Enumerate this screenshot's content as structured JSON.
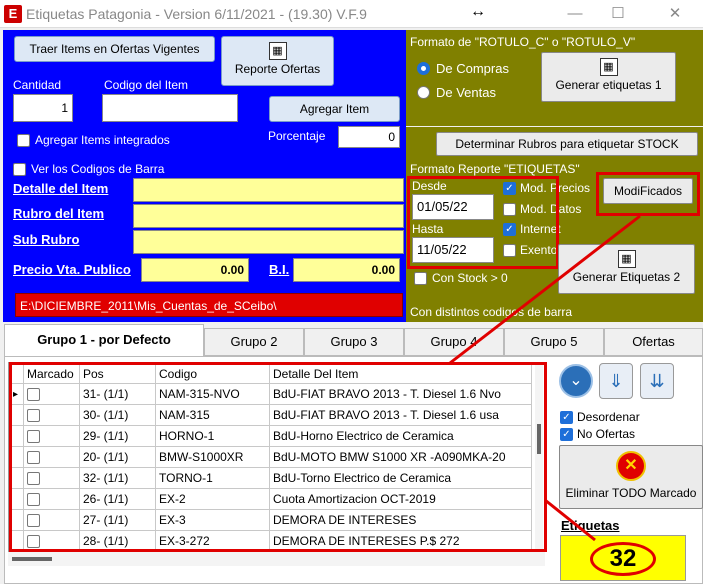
{
  "window": {
    "title": "Etiquetas Patagonia - Version 6/11/2021 - (19.30)  V.F.9",
    "resize_glyph": "↔",
    "minimize": "—",
    "maximize": "☐",
    "close": "✕"
  },
  "top_left": {
    "traer_btn": "Traer Items en Ofertas Vigentes",
    "reporte_btn": "Reporte Ofertas",
    "cantidad_label": "Cantidad",
    "cantidad_value": "1",
    "codigo_label": "Codigo del Item",
    "codigo_value": "",
    "agregar_btn": "Agregar Item",
    "integrados_label": "Agregar Items integrados",
    "porcentaje_label": "Porcentaje",
    "porcentaje_value": "0",
    "ver_codigos_label": "Ver los Codigos de Barra",
    "detalle_label": "Detalle del Item",
    "rubro_label": "Rubro del Item",
    "subrubro_label": "Sub Rubro",
    "precio_label": "Precio Vta. Publico",
    "precio_value": "0.00",
    "bi_label": "B.I.",
    "bi_value": "0.00",
    "path": "E:\\DICIEMBRE_2011\\Mis_Cuentas_de_SCeibo\\"
  },
  "right": {
    "formato_label": "Formato de \"ROTULO_C\" o \"ROTULO_V\"",
    "compras_label": "De Compras",
    "ventas_label": "De Ventas",
    "gen1_btn": "Generar etiquetas 1",
    "determinar_btn": "Determinar Rubros para etiquetar STOCK",
    "formato_rep_label": "Formato Reporte \"ETIQUETAS\"",
    "desde_label": "Desde",
    "desde_value": "01/05/22",
    "hasta_label": "Hasta",
    "hasta_value": "11/05/22",
    "mod_precios": "Mod. Precios",
    "mod_datos": "Mod. Datos",
    "internet": "Internet",
    "exentos": "Exentos",
    "modificados_btn": "ModiFicados",
    "gen2_btn": "Generar Etiquetas 2",
    "con_stock": "Con Stock > 0",
    "distintos": "Con distintos codigos de barra"
  },
  "tabs": [
    "Grupo 1 - por Defecto",
    "Grupo 2",
    "Grupo 3",
    "Grupo 4",
    "Grupo 5",
    "Ofertas"
  ],
  "grid": {
    "headers": [
      "Marcado",
      "Pos",
      "Codigo",
      "Detalle Del Item"
    ],
    "rows": [
      {
        "pos": "31- (1/1)",
        "codigo": "NAM-315-NVO",
        "detalle": "BdU-FIAT BRAVO 2013 - T. Diesel 1.6 Nvo"
      },
      {
        "pos": "30- (1/1)",
        "codigo": "NAM-315",
        "detalle": "BdU-FIAT BRAVO 2013 - T. Diesel 1.6 usa"
      },
      {
        "pos": "29- (1/1)",
        "codigo": "HORNO-1",
        "detalle": "BdU-Horno Electrico de Ceramica"
      },
      {
        "pos": "20- (1/1)",
        "codigo": "BMW-S1000XR",
        "detalle": "BdU-MOTO BMW S1000 XR -A090MKA-20"
      },
      {
        "pos": "32- (1/1)",
        "codigo": "TORNO-1",
        "detalle": "BdU-Torno Electrico de Ceramica"
      },
      {
        "pos": "26- (1/1)",
        "codigo": "EX-2",
        "detalle": "Cuota Amortizacion OCT-2019"
      },
      {
        "pos": "27- (1/1)",
        "codigo": "EX-3",
        "detalle": "DEMORA DE INTERESES"
      },
      {
        "pos": "28- (1/1)",
        "codigo": "EX-3-272",
        "detalle": "DEMORA DE INTERESES  P.$ 272"
      }
    ]
  },
  "side": {
    "desordenar": "Desordenar",
    "no_ofertas": "No Ofertas",
    "eliminar_btn": "Eliminar TODO Marcado",
    "etiquetas_label": "Etiquetas",
    "etiquetas_count": "32"
  },
  "colors": {
    "accent": "#0000ff",
    "olive": "#808000",
    "highlight": "#e00000",
    "yellow": "#ffff99"
  }
}
